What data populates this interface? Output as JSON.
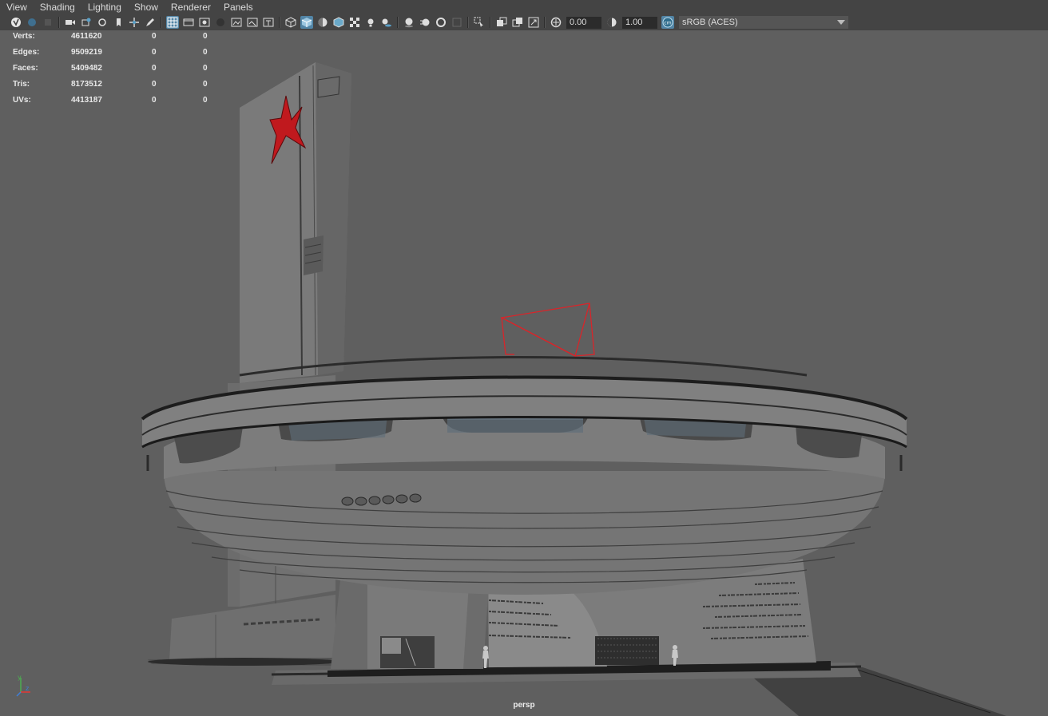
{
  "menu": [
    "View",
    "Shading",
    "Lighting",
    "Show",
    "Renderer",
    "Panels"
  ],
  "toolbar": {
    "exposure": "0.00",
    "gamma": "1.00",
    "color_space": "sRGB (ACES)",
    "icons": [
      "select-camera-icon",
      "camera-attributes-icon",
      "bookmark-icon",
      "image-plane-icon",
      "2d-pan-zoom-icon",
      "grease-pencil-icon",
      "grid-icon",
      "film-gate-icon",
      "resolution-gate-icon",
      "gate-mask-icon",
      "field-chart-icon",
      "safe-action-icon",
      "safe-title-icon",
      "wireframe-icon",
      "smooth-shade-icon",
      "use-default-material-icon",
      "wireframe-on-shaded-icon",
      "xray-icon",
      "textured-icon",
      "lights-icon",
      "shadows-icon",
      "screen-space-ao-icon",
      "motion-blur-icon",
      "multisample-aa-icon",
      "depth-of-field-icon",
      "isolate-select-icon",
      "xray-joints-icon",
      "xray-active-icon",
      "backface-culling-icon",
      "exposure-icon",
      "gamma-icon",
      "color-management-icon"
    ]
  },
  "hud": {
    "rows": [
      {
        "label": "Verts:",
        "v1": "4611620",
        "v2": "0",
        "v3": "0"
      },
      {
        "label": "Edges:",
        "v1": "9509219",
        "v2": "0",
        "v3": "0"
      },
      {
        "label": "Faces:",
        "v1": "5409482",
        "v2": "0",
        "v3": "0"
      },
      {
        "label": "Tris:",
        "v1": "8173512",
        "v2": "0",
        "v3": "0"
      },
      {
        "label": "UVs:",
        "v1": "4413187",
        "v2": "0",
        "v3": "0"
      }
    ]
  },
  "camera": "persp",
  "axis": {
    "y": "y",
    "z": "z"
  },
  "colors": {
    "accent": "#5285a6",
    "star": "#c0191e",
    "wire_selection": "#d8252a",
    "viewport_bg": "#5f5f5f",
    "panel": "#444444"
  }
}
